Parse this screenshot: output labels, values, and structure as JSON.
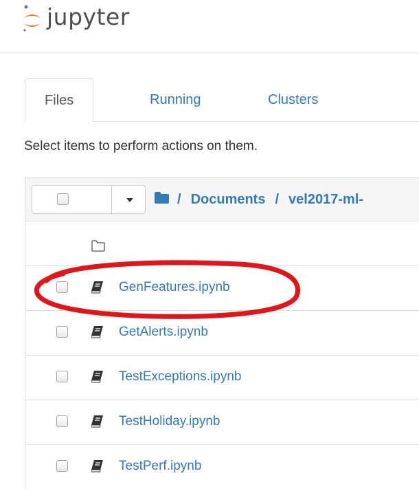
{
  "app": {
    "logo_text": "jupyter"
  },
  "tabs": [
    {
      "label": "Files",
      "active": true
    },
    {
      "label": "Running",
      "active": false
    },
    {
      "label": "Clusters",
      "active": false
    }
  ],
  "hint": "Select items to perform actions on them.",
  "breadcrumb": {
    "slash": "/",
    "items": [
      "Documents",
      "vel2017-ml-"
    ]
  },
  "files": [
    {
      "name": "GenFeatures.ipynb",
      "icon": "notebook-icon"
    },
    {
      "name": "GetAlerts.ipynb",
      "icon": "notebook-icon"
    },
    {
      "name": "TestExceptions.ipynb",
      "icon": "notebook-icon"
    },
    {
      "name": "TestHoliday.ipynb",
      "icon": "notebook-icon"
    },
    {
      "name": "TestPerf.ipynb",
      "icon": "notebook-icon"
    }
  ],
  "colors": {
    "link": "#337ab7",
    "annotation": "#e0161b",
    "logo_orange": "#f37726"
  }
}
